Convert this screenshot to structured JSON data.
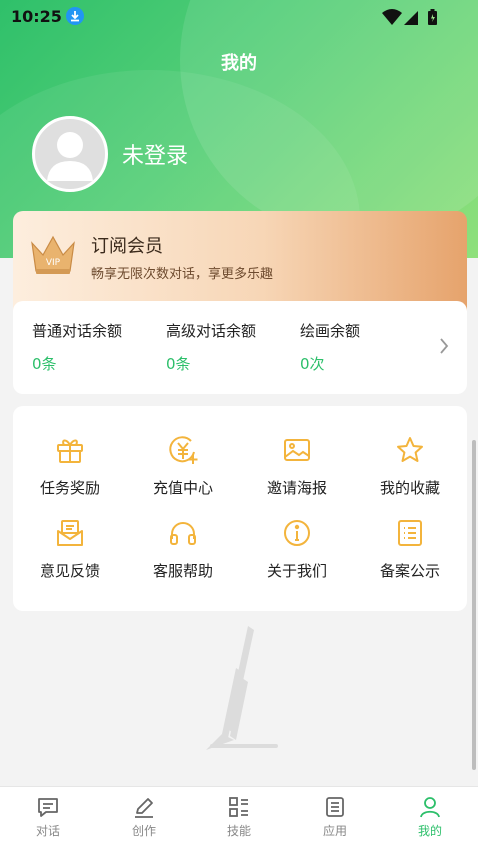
{
  "status_bar": {
    "time": "10:25"
  },
  "header": {
    "title": "我的"
  },
  "profile": {
    "login_text": "未登录"
  },
  "vip": {
    "title": "订阅会员",
    "subtitle": "畅享无限次数对话，享更多乐趣",
    "badge": "VIP"
  },
  "balances": [
    {
      "label": "普通对话余额",
      "value": "0条"
    },
    {
      "label": "高级对话余额",
      "value": "0条"
    },
    {
      "label": "绘画余额",
      "value": "0次"
    }
  ],
  "menu": [
    {
      "label": "任务奖励",
      "icon": "gift-icon"
    },
    {
      "label": "充值中心",
      "icon": "yuan-add-icon"
    },
    {
      "label": "邀请海报",
      "icon": "image-icon"
    },
    {
      "label": "我的收藏",
      "icon": "star-icon"
    },
    {
      "label": "意见反馈",
      "icon": "mail-icon"
    },
    {
      "label": "客服帮助",
      "icon": "headset-icon"
    },
    {
      "label": "关于我们",
      "icon": "info-icon"
    },
    {
      "label": "备案公示",
      "icon": "list-icon"
    }
  ],
  "tabs": [
    {
      "label": "对话",
      "icon": "chat-icon",
      "active": false
    },
    {
      "label": "创作",
      "icon": "pen-icon",
      "active": false
    },
    {
      "label": "技能",
      "icon": "grid-list-icon",
      "active": false
    },
    {
      "label": "应用",
      "icon": "doc-icon",
      "active": false
    },
    {
      "label": "我的",
      "icon": "user-icon",
      "active": true
    }
  ],
  "colors": {
    "primary_green": "#2cbf6a",
    "icon_orange": "#f3b43c",
    "vip_gold": "#e6a36c"
  }
}
